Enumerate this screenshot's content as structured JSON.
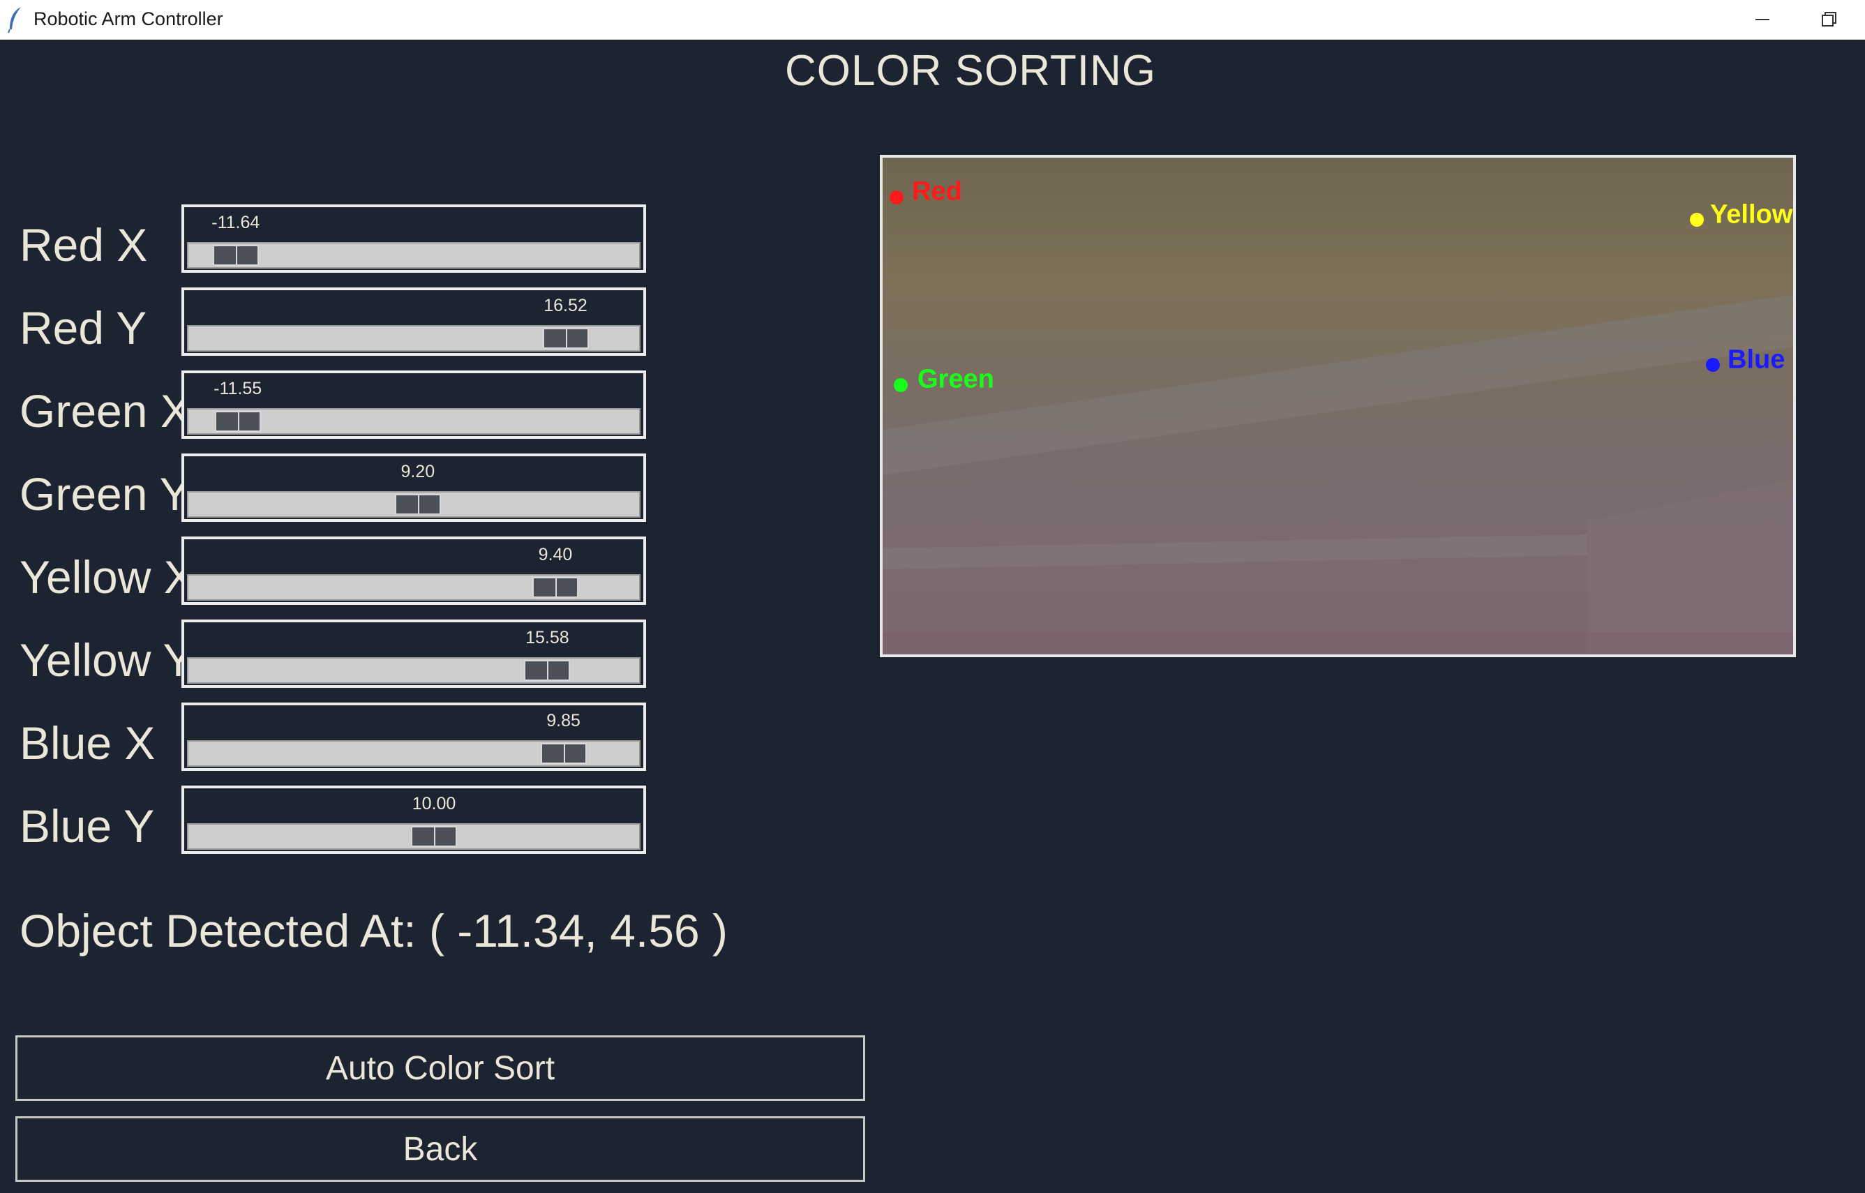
{
  "window": {
    "title": "Robotic Arm Controller"
  },
  "page": {
    "title": "COLOR SORTING"
  },
  "sliders": [
    {
      "label": "Red X",
      "value": "-11.64",
      "level": 0.06
    },
    {
      "label": "Red Y",
      "value": "16.52",
      "level": 0.875
    },
    {
      "label": "Green X",
      "value": "-11.55",
      "level": 0.065
    },
    {
      "label": "Green Y",
      "value": "9.20",
      "level": 0.51
    },
    {
      "label": "Yellow X",
      "value": "9.40",
      "level": 0.85
    },
    {
      "label": "Yellow Y",
      "value": "15.58",
      "level": 0.83
    },
    {
      "label": "Blue X",
      "value": "9.85",
      "level": 0.87
    },
    {
      "label": "Blue Y",
      "value": "10.00",
      "level": 0.55
    }
  ],
  "detection": {
    "text": "Object Detected At: ( -11.34, 4.56 )"
  },
  "buttons": {
    "auto_sort": "Auto Color Sort",
    "back": "Back"
  },
  "camera": {
    "markers": [
      {
        "label": "Red",
        "color": "#ff1a1a"
      },
      {
        "label": "Yellow",
        "color": "#ffff1a"
      },
      {
        "label": "Green",
        "color": "#1aff1a"
      },
      {
        "label": "Blue",
        "color": "#1a1aff"
      }
    ]
  }
}
